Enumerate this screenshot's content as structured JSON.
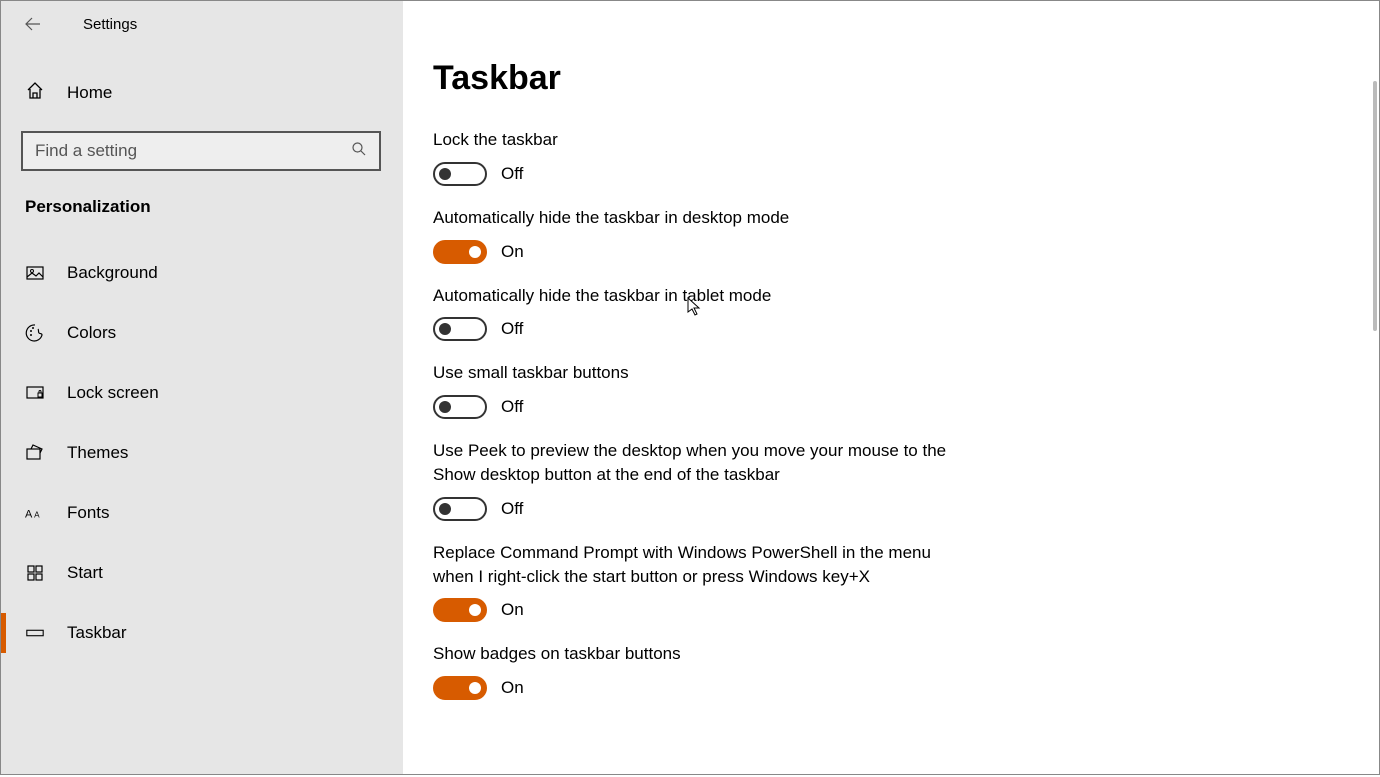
{
  "header": {
    "title": "Settings"
  },
  "home_label": "Home",
  "search": {
    "placeholder": "Find a setting"
  },
  "section": "Personalization",
  "nav": [
    {
      "label": "Background"
    },
    {
      "label": "Colors"
    },
    {
      "label": "Lock screen"
    },
    {
      "label": "Themes"
    },
    {
      "label": "Fonts"
    },
    {
      "label": "Start"
    },
    {
      "label": "Taskbar"
    }
  ],
  "page_title": "Taskbar",
  "state_on": "On",
  "state_off": "Off",
  "settings": [
    {
      "label": "Lock the taskbar",
      "on": false
    },
    {
      "label": "Automatically hide the taskbar in desktop mode",
      "on": true
    },
    {
      "label": "Automatically hide the taskbar in tablet mode",
      "on": false
    },
    {
      "label": "Use small taskbar buttons",
      "on": false
    },
    {
      "label": "Use Peek to preview the desktop when you move your mouse to the Show desktop button at the end of the taskbar",
      "on": false
    },
    {
      "label": "Replace Command Prompt with Windows PowerShell in the menu when I right-click the start button or press Windows key+X",
      "on": true
    },
    {
      "label": "Show badges on taskbar buttons",
      "on": true
    }
  ],
  "colors": {
    "accent": "#d75b00"
  }
}
